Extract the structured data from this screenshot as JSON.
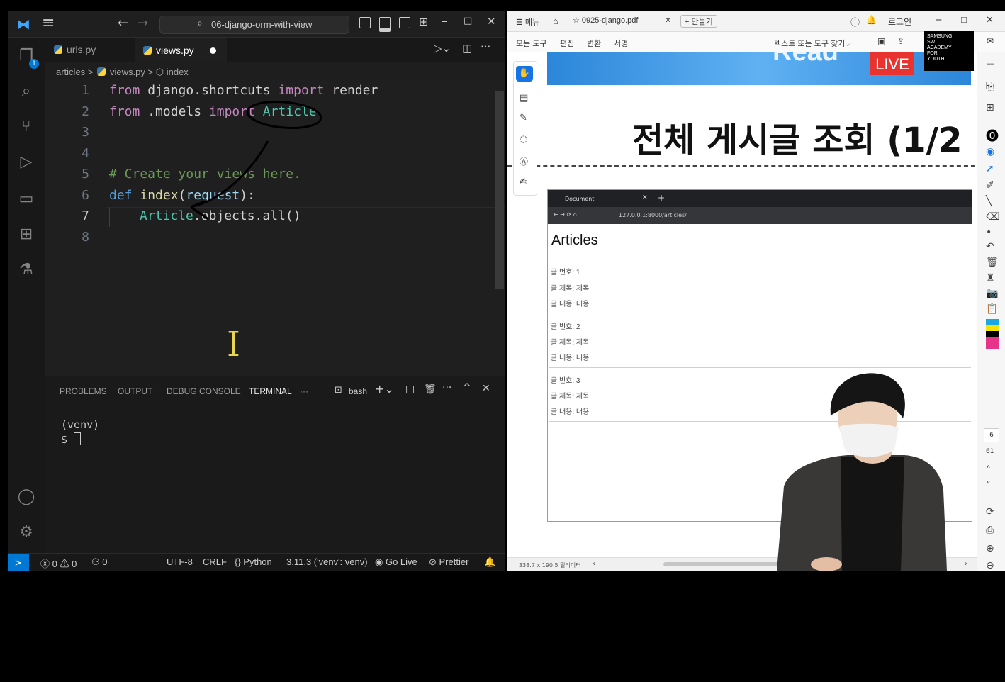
{
  "vscode": {
    "title": "06-django-orm-with-view",
    "tabs": [
      {
        "label": "urls.py"
      },
      {
        "label": "views.py"
      }
    ],
    "breadcrumb": [
      "articles",
      ">",
      "views.py",
      ">",
      "index"
    ],
    "code_lines": [
      {
        "num": "1"
      },
      {
        "num": "2"
      },
      {
        "num": "3"
      },
      {
        "num": "4"
      },
      {
        "num": "5"
      },
      {
        "num": "6"
      },
      {
        "num": "7"
      },
      {
        "num": "8"
      }
    ],
    "code": {
      "l1_from": "from",
      "l1_mod": " django.shortcuts ",
      "l1_import": "import",
      "l1_name": " render",
      "l2_from": "from",
      "l2_mod": " .models ",
      "l2_import": "import",
      "l2_name": " Article",
      "l5": "# Create your views here.",
      "l6_def": "def",
      "l6_fn": " index",
      "l6_open": "(",
      "l6_param": "request",
      "l6_close": "):",
      "l7_cls": "Article",
      "l7_rest": ".objects.all()"
    },
    "panel_tabs": [
      "PROBLEMS",
      "OUTPUT",
      "DEBUG CONSOLE",
      "TERMINAL",
      "···"
    ],
    "terminal_shell": "bash",
    "terminal_lines": [
      "(venv)",
      "$ "
    ],
    "status": {
      "errors": "0",
      "warnings": "0",
      "ports": "0",
      "encoding": "UTF-8",
      "eol": "CRLF",
      "language": "Python",
      "interpreter": "3.11.3 ('venv': venv)",
      "golive": "Go Live",
      "prettier": "Prettier"
    }
  },
  "pdf": {
    "menu_label": "메뉴",
    "tab_label": "0925-django.pdf",
    "new_label": "+ 만들기",
    "login": "로그인",
    "tools": [
      "모든 도구",
      "편집",
      "변환",
      "서명"
    ],
    "search_placeholder": "텍스트 또는 도구 찾기",
    "banner_word": "Read",
    "live_badge": "LIVE",
    "academy_logo": [
      "SAMSUNG",
      "SW",
      "ACADEMY",
      "FOR",
      "YOUTH"
    ],
    "slide_title": "전체 게시글 조회 (1/2",
    "browser_tab": "Document",
    "browser_url": "127.0.0.1:8000/articles/",
    "articles_heading": "Articles",
    "articles": [
      {
        "no": "글 번호: 1",
        "title": "글 제목: 제목",
        "content": "글 내용: 내용"
      },
      {
        "no": "글 번호: 2",
        "title": "글 제목: 제목",
        "content": "글 내용: 내용"
      },
      {
        "no": "글 번호: 3",
        "title": "글 제목: 제목",
        "content": "글 내용: 내용"
      }
    ],
    "page_current": "6",
    "page_total": "61",
    "page_size": "338.7 x 190.5 밀리미터"
  }
}
